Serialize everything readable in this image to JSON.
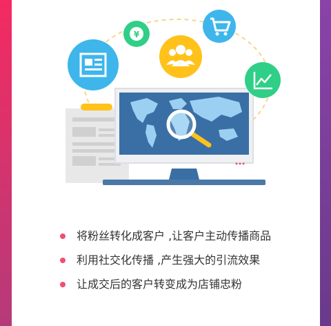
{
  "colors": {
    "accent_gradient_top": "#f42a62",
    "accent_gradient_bottom": "#b53a7a",
    "bullet": "#f0506e",
    "monitor_screen": "#3a6fa6",
    "map": "#9cd0f2",
    "news_circle": "#3eb6ec",
    "yuan_circle": "#2fcf87",
    "users_circle": "#ffc21a",
    "cart_circle": "#3eb6ec",
    "chart_circle": "#2fcf87"
  },
  "illustration": {
    "icons": [
      "news-icon",
      "yuan-icon",
      "users-icon",
      "cart-icon",
      "chart-icon",
      "magnifier-icon"
    ],
    "yuan_symbol": "¥"
  },
  "features": [
    {
      "text": "将粉丝转化成客户 ,让客户主动传播商品"
    },
    {
      "text": "利用社交化传播 ,产生强大的引流效果"
    },
    {
      "text": "让成交后的客户转变成为店铺忠粉"
    }
  ]
}
